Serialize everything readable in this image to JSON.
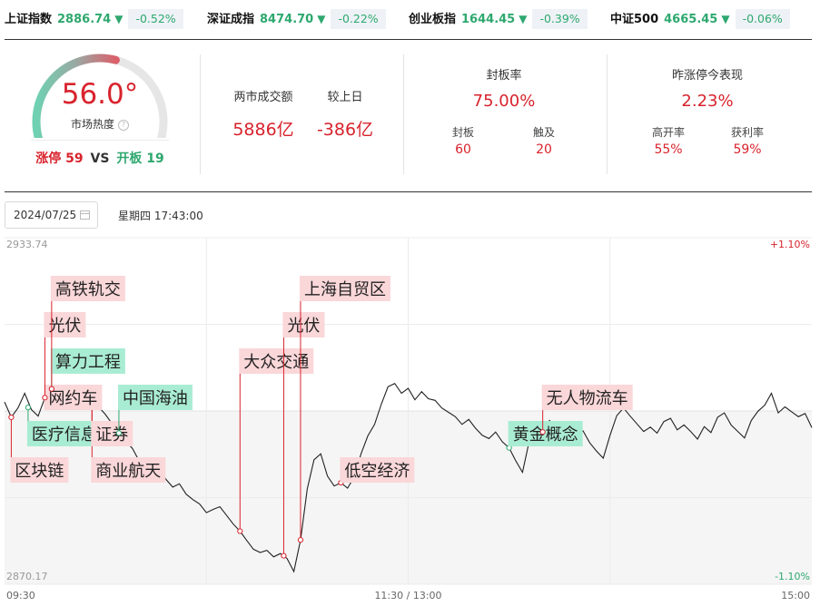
{
  "indices": [
    {
      "name": "上证指数",
      "value": "2886.74",
      "change": "-0.52%"
    },
    {
      "name": "深证成指",
      "value": "8474.70",
      "change": "-0.22%"
    },
    {
      "name": "创业板指",
      "value": "1644.45",
      "change": "-0.39%"
    },
    {
      "name": "中证500",
      "value": "4665.45",
      "change": "-0.06%"
    }
  ],
  "heat": {
    "value": "56.0°",
    "label": "市场热度",
    "help_icon": "?",
    "level": 0.56,
    "limit_up_label": "涨停",
    "limit_up_count": "59",
    "vs": "VS",
    "open_board_label": "开板",
    "open_board_count": "19"
  },
  "turnover": {
    "label": "两市成交额",
    "value": "5886亿",
    "compare_label": "较上日",
    "compare_value": "-386亿"
  },
  "seal_rate": {
    "title": "封板率",
    "value": "75.00%",
    "sealed_label": "封板",
    "sealed_value": "60",
    "touched_label": "触及",
    "touched_value": "20"
  },
  "yesterday_limit": {
    "title": "昨涨停今表现",
    "value": "2.23%",
    "high_open_label": "高开率",
    "high_open_value": "55%",
    "profit_label": "获利率",
    "profit_value": "59%"
  },
  "date": {
    "value": "2024/07/25",
    "weekday_time": "星期四 17:43:00"
  },
  "colors": {
    "up": "#d8232d",
    "down": "#2ea86f",
    "up_tag_bg": "#fad7d9",
    "down_tag_bg": "#a9ecd4",
    "line": "#222222"
  },
  "chart_data": {
    "type": "line",
    "x_ticks": [
      "09:30",
      "11:30 / 13:00",
      "15:00"
    ],
    "y_max_label": "2933.74",
    "y_min_label": "2870.17",
    "ylim": [
      2870.17,
      2933.74
    ],
    "pct_max_label": "+1.10%",
    "pct_min_label": "-1.10%",
    "minutes_total": 240,
    "series": [
      {
        "values": [
          [
            0,
            2903.6
          ],
          [
            2,
            2900.8
          ],
          [
            4,
            2902.5
          ],
          [
            6,
            2905.2
          ],
          [
            8,
            2902.2
          ],
          [
            10,
            2901.0
          ],
          [
            12,
            2904.4
          ],
          [
            14,
            2906.0
          ],
          [
            16,
            2903.8
          ],
          [
            18,
            2906.5
          ],
          [
            20,
            2904.0
          ],
          [
            22,
            2904.5
          ],
          [
            24,
            2903.2
          ],
          [
            26,
            2903.8
          ],
          [
            28,
            2902.7
          ],
          [
            30,
            2901.3
          ],
          [
            32,
            2899.6
          ],
          [
            34,
            2897.9
          ],
          [
            36,
            2896.4
          ],
          [
            38,
            2895.1
          ],
          [
            40,
            2892.8
          ],
          [
            42,
            2891.8
          ],
          [
            44,
            2890.9
          ],
          [
            46,
            2891.5
          ],
          [
            48,
            2889.4
          ],
          [
            50,
            2888.0
          ],
          [
            52,
            2888.6
          ],
          [
            54,
            2886.7
          ],
          [
            56,
            2885.7
          ],
          [
            58,
            2884.9
          ],
          [
            60,
            2883.3
          ],
          [
            62,
            2883.9
          ],
          [
            64,
            2884.4
          ],
          [
            66,
            2882.8
          ],
          [
            68,
            2881.2
          ],
          [
            70,
            2879.9
          ],
          [
            72,
            2878.2
          ],
          [
            74,
            2876.6
          ],
          [
            76,
            2876.0
          ],
          [
            78,
            2876.4
          ],
          [
            80,
            2875.2
          ],
          [
            82,
            2875.8
          ],
          [
            84,
            2874.9
          ],
          [
            86,
            2872.5
          ],
          [
            88,
            2878.3
          ],
          [
            90,
            2887.7
          ],
          [
            92,
            2893.0
          ],
          [
            94,
            2894.1
          ],
          [
            96,
            2890.0
          ],
          [
            98,
            2888.2
          ],
          [
            100,
            2888.8
          ],
          [
            102,
            2887.8
          ],
          [
            104,
            2889.9
          ],
          [
            106,
            2894.1
          ],
          [
            108,
            2897.4
          ],
          [
            110,
            2899.5
          ],
          [
            112,
            2903.2
          ],
          [
            114,
            2906.4
          ],
          [
            116,
            2907.0
          ],
          [
            118,
            2905.2
          ],
          [
            120,
            2906.1
          ],
          [
            122,
            2904.0
          ],
          [
            124,
            2905.5
          ],
          [
            126,
            2904.2
          ],
          [
            128,
            2903.9
          ],
          [
            130,
            2902.5
          ],
          [
            132,
            2901.7
          ],
          [
            134,
            2900.9
          ],
          [
            136,
            2899.5
          ],
          [
            138,
            2900.4
          ],
          [
            140,
            2898.8
          ],
          [
            142,
            2897.5
          ],
          [
            144,
            2896.9
          ],
          [
            146,
            2898.1
          ],
          [
            148,
            2896.3
          ],
          [
            150,
            2895.2
          ],
          [
            152,
            2892.8
          ],
          [
            154,
            2890.7
          ],
          [
            156,
            2896.5
          ],
          [
            158,
            2899.2
          ],
          [
            160,
            2898.1
          ],
          [
            162,
            2900.2
          ],
          [
            164,
            2898.8
          ],
          [
            166,
            2899.4
          ],
          [
            168,
            2897.9
          ],
          [
            170,
            2897.6
          ],
          [
            172,
            2898.3
          ],
          [
            174,
            2896.1
          ],
          [
            176,
            2894.6
          ],
          [
            178,
            2893.3
          ],
          [
            180,
            2897.5
          ],
          [
            182,
            2901.1
          ],
          [
            184,
            2902.5
          ],
          [
            186,
            2901.0
          ],
          [
            188,
            2899.6
          ],
          [
            190,
            2898.2
          ],
          [
            192,
            2899.0
          ],
          [
            194,
            2897.9
          ],
          [
            196,
            2900.0
          ],
          [
            198,
            2900.6
          ],
          [
            200,
            2898.5
          ],
          [
            202,
            2899.4
          ],
          [
            204,
            2898.2
          ],
          [
            206,
            2896.8
          ],
          [
            208,
            2899.1
          ],
          [
            210,
            2898.0
          ],
          [
            212,
            2900.8
          ],
          [
            214,
            2901.6
          ],
          [
            216,
            2899.4
          ],
          [
            218,
            2898.2
          ],
          [
            220,
            2897.0
          ],
          [
            222,
            2900.2
          ],
          [
            224,
            2901.9
          ],
          [
            226,
            2903.0
          ],
          [
            228,
            2905.2
          ],
          [
            230,
            2901.6
          ],
          [
            232,
            2902.7
          ],
          [
            234,
            2901.8
          ],
          [
            236,
            2900.9
          ],
          [
            238,
            2901.5
          ],
          [
            240,
            2898.9
          ]
        ]
      }
    ],
    "annotations": [
      {
        "label": "区块链",
        "minute": 2,
        "value": 2900.8,
        "kind": "up",
        "row": 0
      },
      {
        "label": "商业航天",
        "minute": 26,
        "value": 2903.8,
        "kind": "up",
        "row": 0
      },
      {
        "label": "医疗信息",
        "minute": 7,
        "value": 2902.6,
        "kind": "down",
        "row": 1
      },
      {
        "label": "证券",
        "minute": 26,
        "value": 2903.8,
        "kind": "up",
        "row": 1
      },
      {
        "label": "网约车",
        "minute": 12,
        "value": 2904.4,
        "kind": "up",
        "row": 2
      },
      {
        "label": "中国海油",
        "minute": 34,
        "value": 2897.9,
        "kind": "down",
        "row": 2
      },
      {
        "label": "算力工程",
        "minute": 14,
        "value": 2906.0,
        "kind": "down",
        "row": 3
      },
      {
        "label": "光伏",
        "minute": 12,
        "value": 2904.4,
        "kind": "up",
        "row": 4
      },
      {
        "label": "高铁轨交",
        "minute": 14,
        "value": 2906.0,
        "kind": "up",
        "row": 5
      },
      {
        "label": "大众交通",
        "minute": 70,
        "value": 2879.9,
        "kind": "up",
        "row": 3
      },
      {
        "label": "光伏",
        "minute": 83,
        "value": 2875.4,
        "kind": "up",
        "row": 4
      },
      {
        "label": "上海自贸区",
        "minute": 88,
        "value": 2878.3,
        "kind": "up",
        "row": 5
      },
      {
        "label": "低空经济",
        "minute": 100,
        "value": 2888.8,
        "kind": "up",
        "row": 0
      },
      {
        "label": "黄金概念",
        "minute": 150,
        "value": 2895.2,
        "kind": "down",
        "row": 1
      },
      {
        "label": "无人物流车",
        "minute": 160,
        "value": 2898.1,
        "kind": "up",
        "row": 2
      }
    ]
  }
}
